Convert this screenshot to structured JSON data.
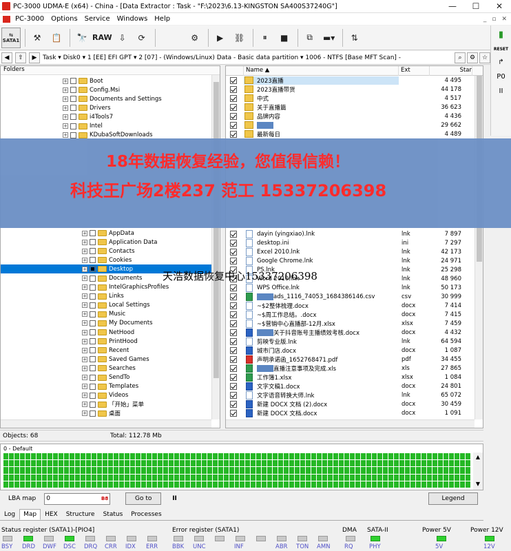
{
  "titlebar": {
    "title": "PC-3000 UDMA-E (x64) - China - [Data Extractor : Task - \"F:\\2023\\6.13-KINGSTON SA400S37240G\"]",
    "min": "—",
    "max": "☐",
    "close": "✕"
  },
  "menu": {
    "items": [
      "PC-3000",
      "Options",
      "Service",
      "Windows",
      "Help"
    ],
    "mdi": [
      "_",
      "▫",
      "✕"
    ]
  },
  "toolbar": {
    "sata_label": "SATA1",
    "raw_label": "RAW"
  },
  "rightbar": {
    "reset": "RESET",
    "pwr": "P0",
    "pause": "II"
  },
  "path": {
    "text": "Task ▾  Disk0 ▾  1 [EE] EFI GPT ▾  2 [07] - (Windows/Linux) Data - Basic data partition ▾  1006 - NTFS [Base MFT Scan] -"
  },
  "folders": {
    "header": "Folders",
    "top": [
      "Boot",
      "Config.Msi",
      "Documents and Settings",
      "Drivers",
      "i4Tools7",
      "Intel",
      "KDubaSoftDownloads"
    ],
    "bottom": [
      "AppData",
      "Application Data",
      "Contacts",
      "Cookies",
      "Desktop",
      "Documents",
      "IntelGraphicsProfiles",
      "Links",
      "Local Settings",
      "Music",
      "My Documents",
      "NetHood",
      "PrintHood",
      "Recent",
      "Saved Games",
      "Searches",
      "SendTo",
      "Templates",
      "Videos",
      "「开始」菜单",
      "桌面"
    ],
    "selected": "Desktop"
  },
  "files": {
    "headers": {
      "name": "Name ▲",
      "ext": "Ext",
      "size": "Star"
    },
    "top": [
      {
        "name": "2023直播",
        "ext": "",
        "size": "4 495",
        "type": "folder",
        "sel": true
      },
      {
        "name": "2023直播带货",
        "ext": "",
        "size": "44 178",
        "type": "folder"
      },
      {
        "name": "中式",
        "ext": "",
        "size": "4 517",
        "type": "folder"
      },
      {
        "name": "关于直播篇",
        "ext": "",
        "size": "36 623",
        "type": "folder"
      },
      {
        "name": "品牌内容",
        "ext": "",
        "size": "4 436",
        "type": "folder"
      },
      {
        "name": "",
        "ext": "",
        "size": "29 662",
        "type": "folder",
        "redact": true
      },
      {
        "name": "最新每日",
        "ext": "",
        "size": "4 489",
        "type": "folder"
      }
    ],
    "bottom": [
      {
        "name": "dayin (yingxiao).lnk",
        "ext": "lnk",
        "size": "7 897",
        "type": "file"
      },
      {
        "name": "desktop.ini",
        "ext": "ini",
        "size": "7 297",
        "type": "file"
      },
      {
        "name": "Excel 2010.lnk",
        "ext": "lnk",
        "size": "42 173",
        "type": "file"
      },
      {
        "name": "Google Chrome.lnk",
        "ext": "lnk",
        "size": "24 971",
        "type": "file"
      },
      {
        "name": "PS.lnk",
        "ext": "lnk",
        "size": "25 298",
        "type": "file"
      },
      {
        "name": "Word 2010.lnk",
        "ext": "lnk",
        "size": "48 960",
        "type": "file"
      },
      {
        "name": "WPS Office.lnk",
        "ext": "lnk",
        "size": "50 173",
        "type": "file"
      },
      {
        "name": "ads_1116_74053_1684386146.csv",
        "ext": "csv",
        "size": "30 999",
        "type": "xls",
        "redact": true
      },
      {
        "name": "~$2整体梳理.docx",
        "ext": "docx",
        "size": "7 414",
        "type": "file"
      },
      {
        "name": "~$周工作总结。.docx",
        "ext": "docx",
        "size": "7 415",
        "type": "file"
      },
      {
        "name": "~$营销中心直播部-12月.xlsx",
        "ext": "xlsx",
        "size": "7 459",
        "type": "file"
      },
      {
        "name": "关于抖音账号主播绩效考核.docx",
        "ext": "docx",
        "size": "4 432",
        "type": "doc",
        "redact": true
      },
      {
        "name": "剪映专业版.lnk",
        "ext": "lnk",
        "size": "64 594",
        "type": "file"
      },
      {
        "name": "城市门店.docx",
        "ext": "docx",
        "size": "1 087",
        "type": "doc"
      },
      {
        "name": "声明承诺函_1652768471.pdf",
        "ext": "pdf",
        "size": "34 455",
        "type": "pdf"
      },
      {
        "name": "直播注意事项及完成.xls",
        "ext": "xls",
        "size": "27 865",
        "type": "xls",
        "redact": true
      },
      {
        "name": "工作簿1.xlsx",
        "ext": "xlsx",
        "size": "1 084",
        "type": "xls"
      },
      {
        "name": "文字文稿1.docx",
        "ext": "docx",
        "size": "24 801",
        "type": "doc"
      },
      {
        "name": "文字语音转换大师.lnk",
        "ext": "lnk",
        "size": "65 072",
        "type": "file"
      },
      {
        "name": "新建 DOCX 文档 (2).docx",
        "ext": "docx",
        "size": "30 459",
        "type": "doc"
      },
      {
        "name": "新建 DOCX 文档.docx",
        "ext": "docx",
        "size": "1 091",
        "type": "doc"
      }
    ]
  },
  "banner": {
    "line1": "18年数据恢复经验，您值得信赖！",
    "line2": "科技王广场2楼237      范工 15337206398"
  },
  "watermark": "天浩数据恢复中心15337206398",
  "status": {
    "objects": "Objects: 68",
    "total": "Total: 112.78 Mb"
  },
  "map": {
    "label": "0 - Default"
  },
  "lba": {
    "label": "LBA map",
    "value": "0",
    "goto": "Go to",
    "pause": "II",
    "legend": "Legend"
  },
  "tabs": [
    "Log",
    "Map",
    "HEX",
    "Structure",
    "Status",
    "Processes"
  ],
  "registers": {
    "status_label": "Status register (SATA1)-[PIO4]",
    "error_label": "Error register (SATA1)",
    "dma_label": "DMA",
    "sata_label": "SATA-II",
    "p5_label": "Power 5V",
    "p12_label": "Power 12V",
    "status_bits": [
      "BSY",
      "DRD",
      "DWF",
      "DSC",
      "DRQ",
      "CRR",
      "IDX",
      "ERR"
    ],
    "error_bits": [
      "BBK",
      "UNC",
      "",
      "INF",
      "",
      "ABR",
      "TON",
      "AMN"
    ],
    "dma_bit": "RQ",
    "sata_bit": "PHY",
    "p5_val": "5V",
    "p12_val": "12V"
  }
}
